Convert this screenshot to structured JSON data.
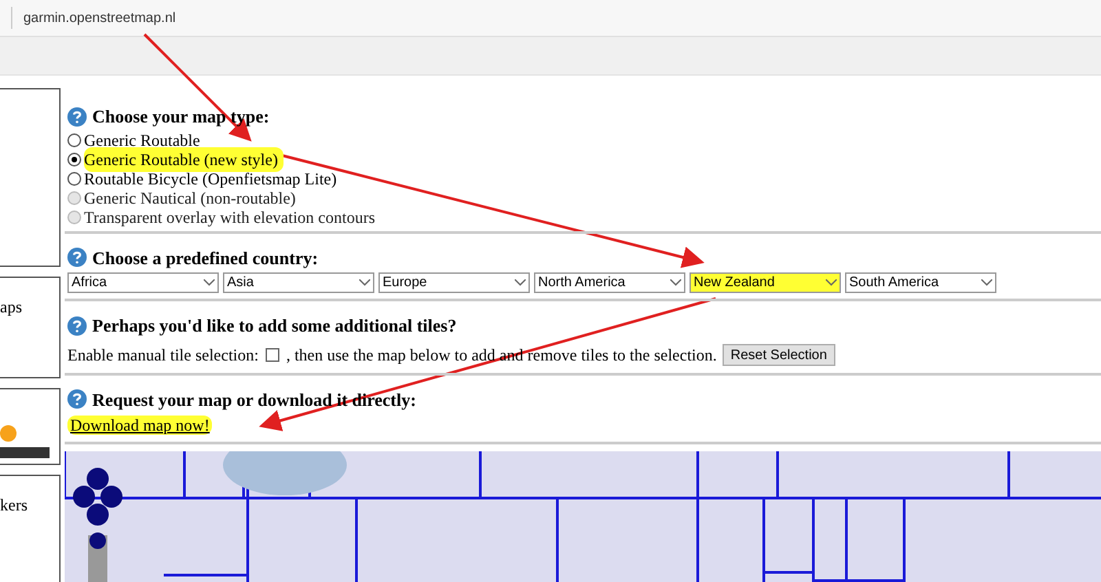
{
  "address_bar": {
    "url": "garmin.openstreetmap.nl"
  },
  "sidebar": {
    "texts": [
      "aps",
      "kers"
    ]
  },
  "map_type": {
    "heading": "Choose your map type:",
    "options": [
      {
        "label": "Generic Routable",
        "selected": false,
        "disabled": false,
        "highlighted": false
      },
      {
        "label": "Generic Routable (new style)",
        "selected": true,
        "disabled": false,
        "highlighted": true
      },
      {
        "label": "Routable Bicycle (Openfietsmap Lite)",
        "selected": false,
        "disabled": false,
        "highlighted": false
      },
      {
        "label": "Generic Nautical (non-routable)",
        "selected": false,
        "disabled": true,
        "highlighted": false
      },
      {
        "label": "Transparent overlay with elevation contours",
        "selected": false,
        "disabled": true,
        "highlighted": false
      }
    ]
  },
  "country": {
    "heading": "Choose a predefined country:",
    "selects": [
      {
        "value": "Africa",
        "highlighted": false
      },
      {
        "value": "Asia",
        "highlighted": false
      },
      {
        "value": "Europe",
        "highlighted": false
      },
      {
        "value": "North America",
        "highlighted": false
      },
      {
        "value": "New Zealand",
        "highlighted": true
      },
      {
        "value": "South America",
        "highlighted": false
      }
    ]
  },
  "tiles": {
    "heading": "Perhaps you'd like to add some additional tiles?",
    "label_before": "Enable manual tile selection:",
    "checked": false,
    "label_after": ", then use the map below to add and remove tiles to the selection.",
    "button": "Reset Selection"
  },
  "request": {
    "heading": "Request your map or download it directly:",
    "link": "Download map now!",
    "highlighted": true
  }
}
